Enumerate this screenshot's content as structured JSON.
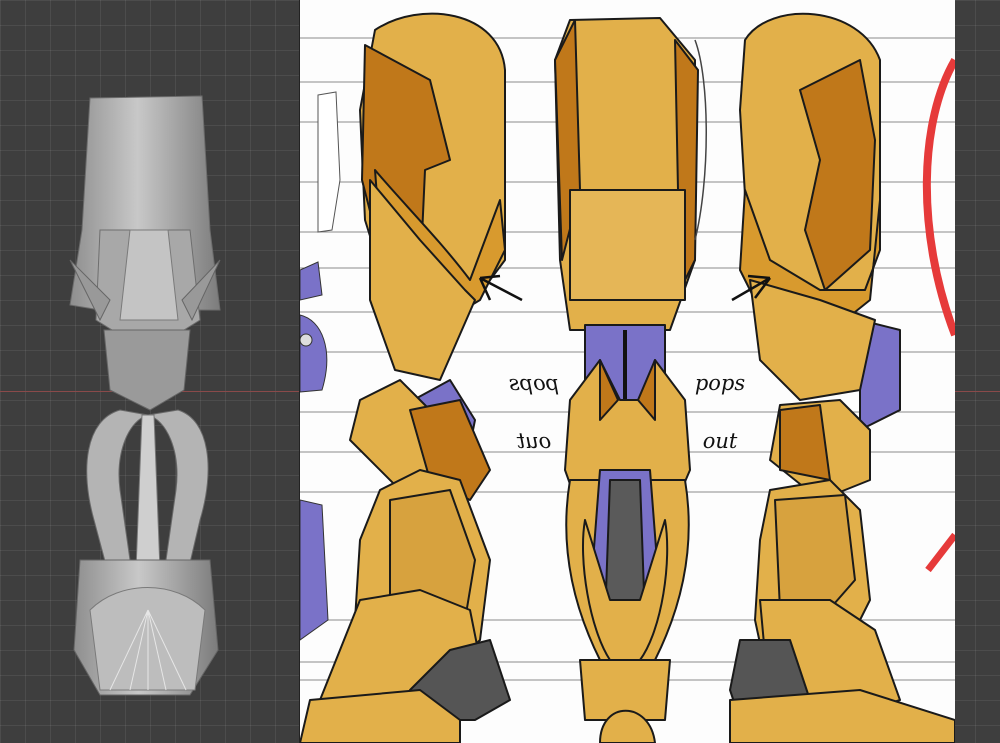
{
  "reference_image": {
    "annotations": {
      "left_top": "pops",
      "left_bottom": "out",
      "right_top": "pops",
      "right_bottom": "out"
    }
  },
  "colors": {
    "viewport_bg": "#3e3e3e",
    "grid_line": "#555555",
    "x_axis": "#8a4a4a",
    "armor_yellow": "#e2b04a",
    "armor_dark": "#c0781a",
    "armor_purple": "#7a72c8",
    "annotation_red": "#e63a3a",
    "mesh_gray": "#b3b3b3"
  }
}
